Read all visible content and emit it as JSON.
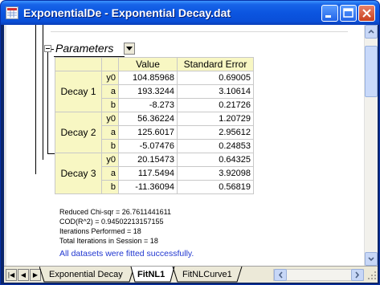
{
  "window": {
    "title": "ExponentialDe - Exponential Decay.dat"
  },
  "report": {
    "section_title": "Parameters",
    "table": {
      "headers": [
        "Value",
        "Standard Error"
      ],
      "groups": [
        {
          "name": "Decay 1",
          "rows": [
            {
              "param": "y0",
              "value": "104.85968",
              "error": "0.69005"
            },
            {
              "param": "a",
              "value": "193.3244",
              "error": "3.10614"
            },
            {
              "param": "b",
              "value": "-8.273",
              "error": "0.21726"
            }
          ]
        },
        {
          "name": "Decay 2",
          "rows": [
            {
              "param": "y0",
              "value": "56.36224",
              "error": "1.20729"
            },
            {
              "param": "a",
              "value": "125.6017",
              "error": "2.95612"
            },
            {
              "param": "b",
              "value": "-5.07476",
              "error": "0.24853"
            }
          ]
        },
        {
          "name": "Decay 3",
          "rows": [
            {
              "param": "y0",
              "value": "20.15473",
              "error": "0.64325"
            },
            {
              "param": "a",
              "value": "117.5494",
              "error": "3.92098"
            },
            {
              "param": "b",
              "value": "-11.36094",
              "error": "0.56819"
            }
          ]
        }
      ]
    },
    "stats": [
      "Reduced Chi-sqr = 26.7611441611",
      "COD(R^2) = 0.94502213157155",
      "Iterations Performed = 18",
      "Total Iterations in Session = 18"
    ],
    "success_message": "All datasets were fitted successfully."
  },
  "tabs": [
    {
      "label": "Exponential Decay",
      "active": false
    },
    {
      "label": "FitNL1",
      "active": true
    },
    {
      "label": "FitNLCurve1",
      "active": false
    }
  ],
  "icons": {
    "window_icon": "worksheet-icon",
    "minimize": "minimize-icon",
    "maximize": "maximize-icon",
    "close": "close-icon"
  },
  "colors": {
    "title_bar": "#0b55e0",
    "table_header_bg": "#f8f7c3",
    "success_text": "#2137d0"
  }
}
